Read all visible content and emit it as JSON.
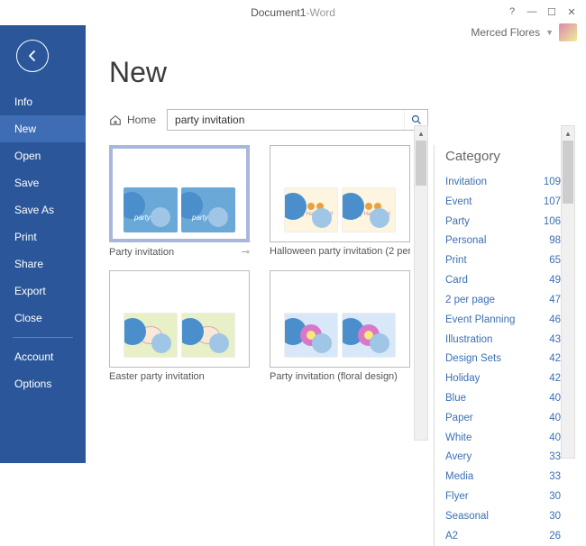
{
  "title": {
    "doc": "Document1",
    "sep": " - ",
    "app": "Word"
  },
  "user": {
    "name": "Merced Flores"
  },
  "sidebar": {
    "items": [
      {
        "label": "Info"
      },
      {
        "label": "New",
        "active": true
      },
      {
        "label": "Open"
      },
      {
        "label": "Save"
      },
      {
        "label": "Save As"
      },
      {
        "label": "Print"
      },
      {
        "label": "Share"
      },
      {
        "label": "Export"
      },
      {
        "label": "Close"
      }
    ],
    "footer": [
      {
        "label": "Account"
      },
      {
        "label": "Options"
      }
    ]
  },
  "page": {
    "heading": "New",
    "home": "Home",
    "search_value": "party invitation"
  },
  "templates": [
    {
      "label": "Party invitation",
      "selected": true,
      "pinned": true,
      "kind": "circles"
    },
    {
      "label": "Halloween party invitation (2 per...",
      "kind": "hallo"
    },
    {
      "label": "Easter party invitation",
      "kind": "easter"
    },
    {
      "label": "Party invitation (floral design)",
      "kind": "floral"
    }
  ],
  "category": {
    "title": "Category",
    "items": [
      {
        "name": "Invitation",
        "count": 109
      },
      {
        "name": "Event",
        "count": 107
      },
      {
        "name": "Party",
        "count": 106
      },
      {
        "name": "Personal",
        "count": 98
      },
      {
        "name": "Print",
        "count": 65
      },
      {
        "name": "Card",
        "count": 49
      },
      {
        "name": "2 per page",
        "count": 47
      },
      {
        "name": "Event Planning",
        "count": 46
      },
      {
        "name": "Illustration",
        "count": 43
      },
      {
        "name": "Design Sets",
        "count": 42
      },
      {
        "name": "Holiday",
        "count": 42
      },
      {
        "name": "Blue",
        "count": 40
      },
      {
        "name": "Paper",
        "count": 40
      },
      {
        "name": "White",
        "count": 40
      },
      {
        "name": "Avery",
        "count": 33
      },
      {
        "name": "Media",
        "count": 33
      },
      {
        "name": "Flyer",
        "count": 30
      },
      {
        "name": "Seasonal",
        "count": 30
      },
      {
        "name": "A2",
        "count": 26
      }
    ]
  }
}
